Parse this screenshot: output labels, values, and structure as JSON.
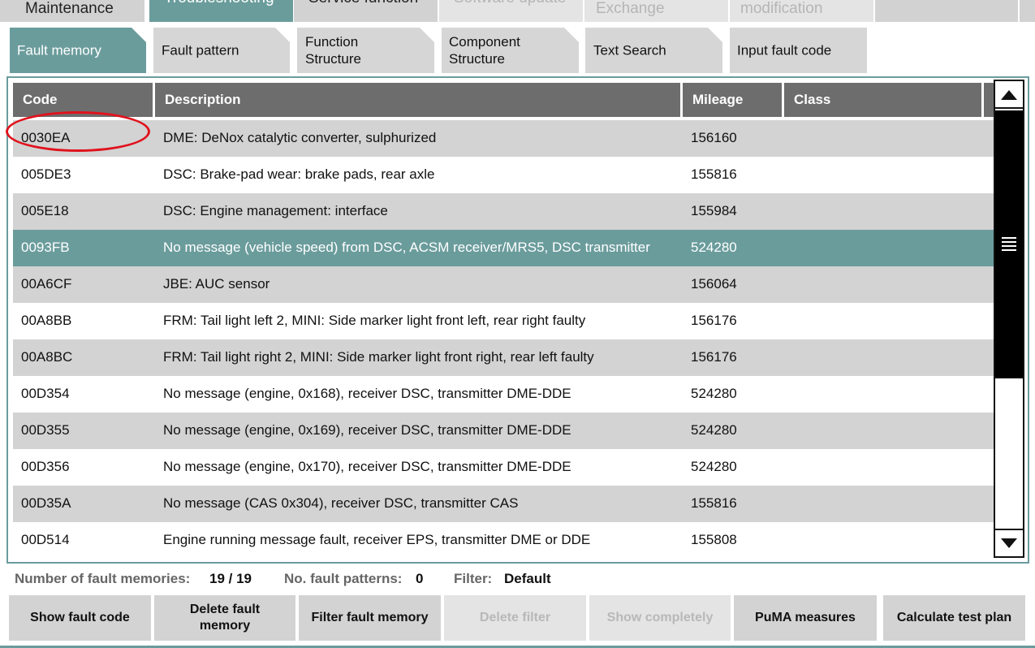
{
  "top_tabs": [
    {
      "label": "Maintenance",
      "state": "normal"
    },
    {
      "label": "Troubleshooting",
      "state": "active"
    },
    {
      "label": "Service function",
      "state": "normal"
    },
    {
      "label": "Software update",
      "state": "disabled"
    },
    {
      "label": "Exchange",
      "state": "disabled"
    },
    {
      "label": "modification",
      "state": "disabled"
    },
    {
      "label": "",
      "state": "normal"
    },
    {
      "label": "",
      "state": "normal"
    }
  ],
  "sub_tabs": [
    {
      "label": "Fault memory",
      "active": true
    },
    {
      "label": "Fault pattern",
      "active": false
    },
    {
      "label": "Function\nStructure",
      "active": false
    },
    {
      "label": "Component\nStructure",
      "active": false
    },
    {
      "label": "Text Search",
      "active": false
    },
    {
      "label": "Input fault code",
      "active": false
    }
  ],
  "table": {
    "columns": [
      "Code",
      "Description",
      "Mileage",
      "Class"
    ],
    "rows": [
      {
        "code": "0030EA",
        "description": "DME: DeNox catalytic converter, sulphurized",
        "mileage": "156160",
        "class": ""
      },
      {
        "code": "005DE3",
        "description": "DSC: Brake-pad wear: brake pads, rear axle",
        "mileage": "155816",
        "class": ""
      },
      {
        "code": "005E18",
        "description": "DSC: Engine management: interface",
        "mileage": "155984",
        "class": ""
      },
      {
        "code": "0093FB",
        "description": "No message (vehicle speed) from DSC, ACSM receiver/MRS5, DSC transmitter",
        "mileage": "524280",
        "class": ""
      },
      {
        "code": "00A6CF",
        "description": "JBE: AUC sensor",
        "mileage": "156064",
        "class": ""
      },
      {
        "code": "00A8BB",
        "description": "FRM: Tail light left 2, MINI: Side marker light front left, rear right faulty",
        "mileage": "156176",
        "class": ""
      },
      {
        "code": "00A8BC",
        "description": "FRM: Tail light right 2, MINI: Side marker light front right, rear left faulty",
        "mileage": "156176",
        "class": ""
      },
      {
        "code": "00D354",
        "description": "No message (engine, 0x168), receiver DSC, transmitter DME-DDE",
        "mileage": "524280",
        "class": ""
      },
      {
        "code": "00D355",
        "description": "No message (engine, 0x169), receiver DSC, transmitter DME-DDE",
        "mileage": "524280",
        "class": ""
      },
      {
        "code": "00D356",
        "description": "No message (engine, 0x170), receiver DSC, transmitter DME-DDE",
        "mileage": "524280",
        "class": ""
      },
      {
        "code": "00D35A",
        "description": "No message (CAS 0x304), receiver DSC, transmitter CAS",
        "mileage": "155816",
        "class": ""
      },
      {
        "code": "00D514",
        "description": "Engine running message fault, receiver EPS, transmitter DME or DDE",
        "mileage": "155808",
        "class": ""
      }
    ],
    "selected_index": 3,
    "highlighted_index": 0
  },
  "status": {
    "count_label": "Number of fault memories:",
    "count_value": "19 / 19",
    "patterns_label": "No. fault patterns:",
    "patterns_value": "0",
    "filter_label": "Filter:",
    "filter_value": "Default"
  },
  "buttons": [
    {
      "label": "Show fault code",
      "enabled": true
    },
    {
      "label": "Delete fault\nmemory",
      "enabled": true
    },
    {
      "label": "Filter fault memory",
      "enabled": true
    },
    {
      "label": "Delete filter",
      "enabled": false
    },
    {
      "label": "Show completely",
      "enabled": false
    },
    {
      "label": "PuMA measures",
      "enabled": true
    },
    {
      "label": "Calculate test plan",
      "enabled": true
    }
  ],
  "colors": {
    "accent": "#6b9c9c",
    "header": "#6d6d6d",
    "row_alt": "#d3d3d3",
    "highlight_ring": "#e0121c"
  },
  "icons": {
    "scroll_up": "triangle-up-icon",
    "scroll_down": "triangle-down-icon",
    "scroll_grip": "grip-lines-icon"
  }
}
